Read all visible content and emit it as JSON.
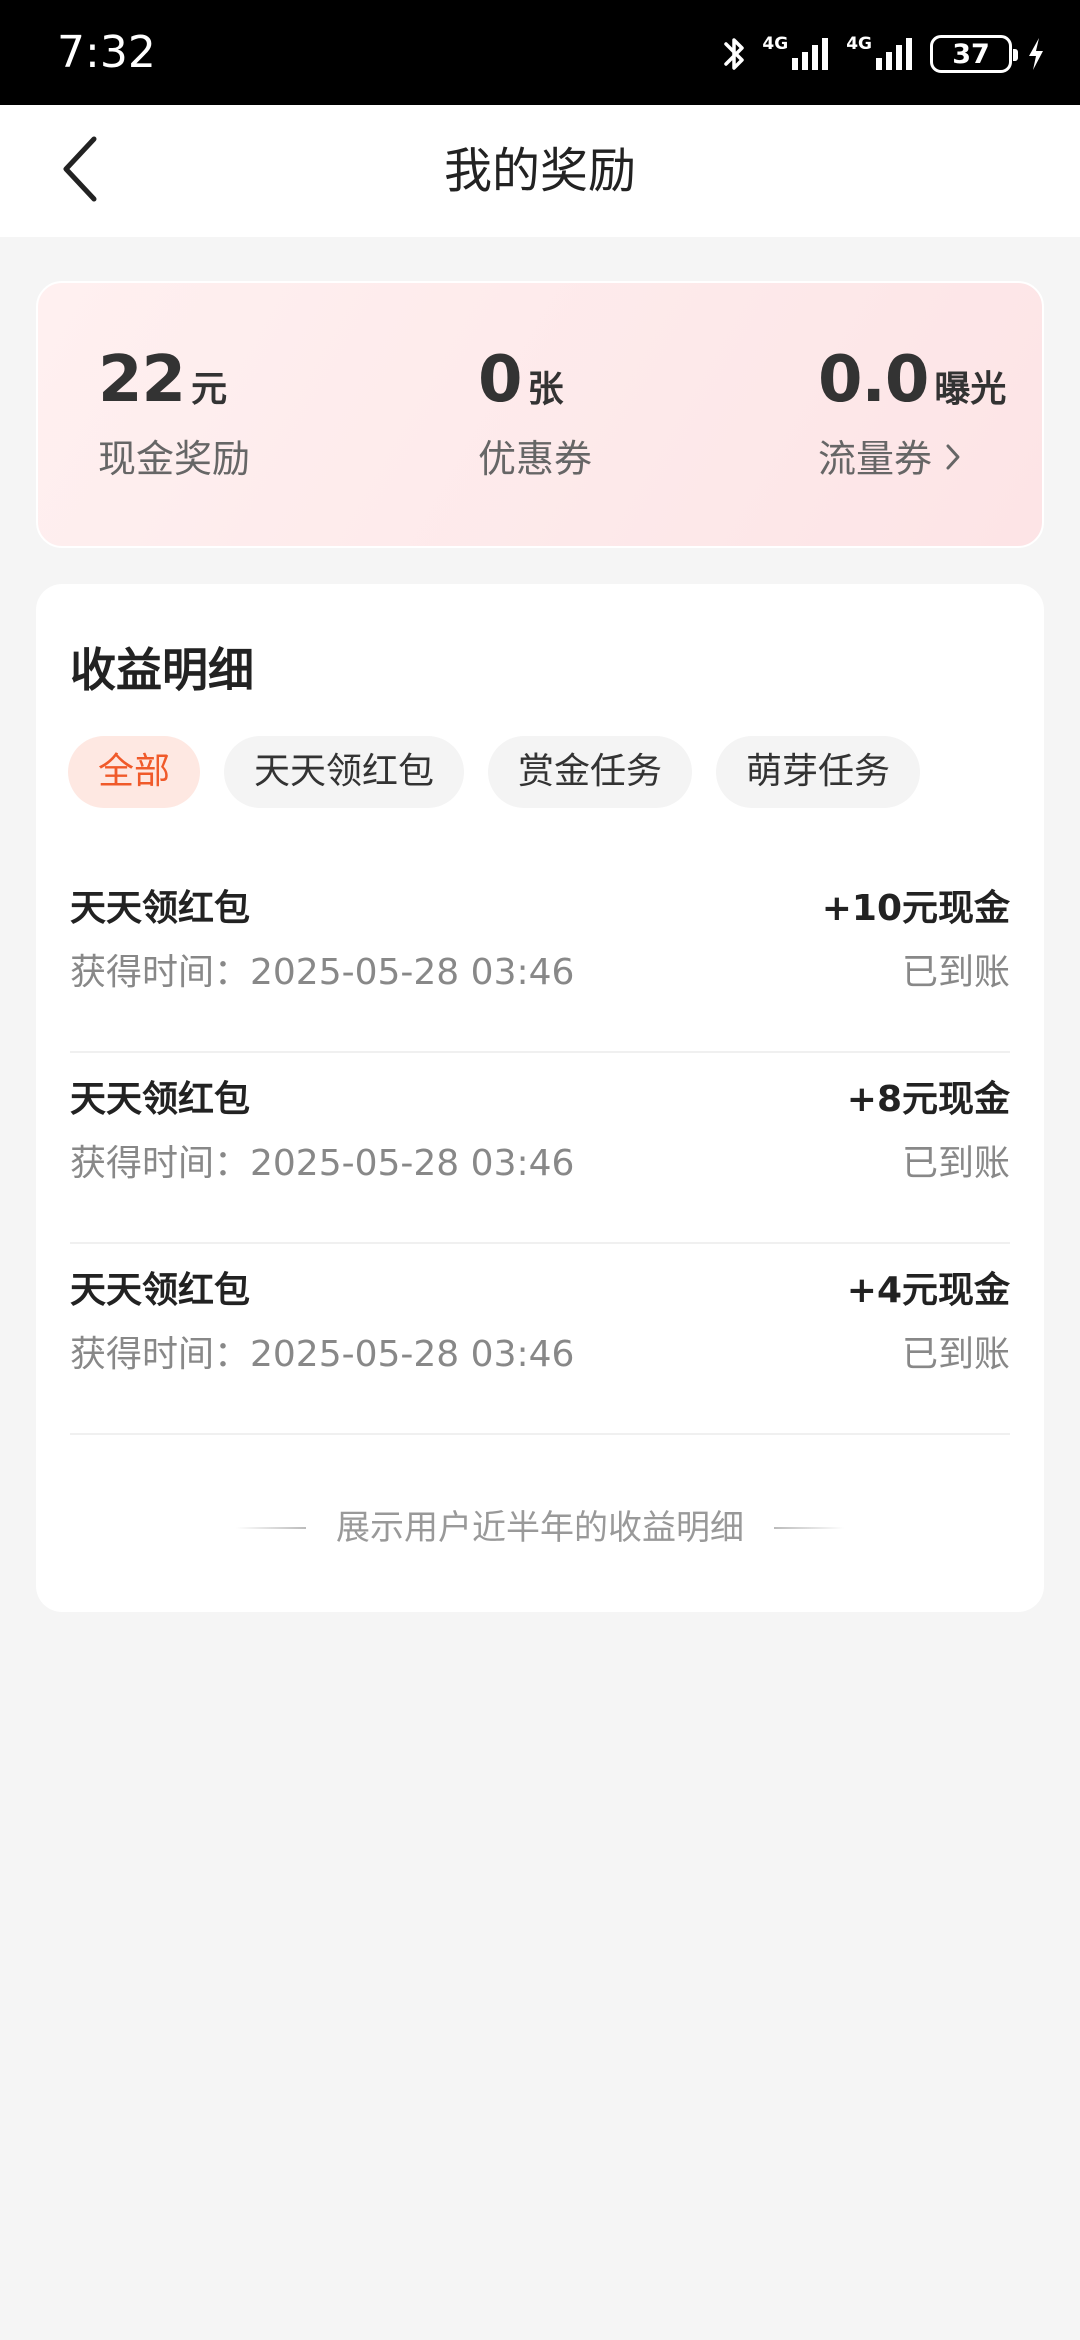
{
  "status_bar": {
    "time": "7:32",
    "network_1": "4G",
    "network_2": "4G",
    "battery": "37",
    "icons": [
      "bluetooth-icon",
      "signal-4g-icon",
      "signal-4g-icon",
      "battery-icon",
      "charging-icon"
    ]
  },
  "header": {
    "title": "我的奖励",
    "back_icon": "chevron-left-icon"
  },
  "summary": {
    "cash": {
      "value": "22",
      "unit": "元",
      "label": "现金奖励"
    },
    "coupon": {
      "value": "0",
      "unit": "张",
      "label": "优惠券"
    },
    "traffic": {
      "value": "0.0",
      "unit": "曝光",
      "label": "流量券",
      "arrow_icon": "chevron-right-icon"
    }
  },
  "details": {
    "title": "收益明细",
    "tabs": [
      {
        "label": "全部",
        "active": true
      },
      {
        "label": "天天领红包",
        "active": false
      },
      {
        "label": "赏金任务",
        "active": false
      },
      {
        "label": "萌芽任务",
        "active": false
      }
    ],
    "records": [
      {
        "title": "天天领红包",
        "amount": "+10元现金",
        "time": "获得时间：2025-05-28 03:46",
        "status": "已到账"
      },
      {
        "title": "天天领红包",
        "amount": "+8元现金",
        "time": "获得时间：2025-05-28 03:46",
        "status": "已到账"
      },
      {
        "title": "天天领红包",
        "amount": "+4元现金",
        "time": "获得时间：2025-05-28 03:46",
        "status": "已到账"
      }
    ],
    "footer_note": "展示用户近半年的收益明细"
  },
  "colors": {
    "accent": "#f05a2a",
    "active_tab_bg": "#fee8e2",
    "summary_bg": "#fde9ea",
    "page_bg": "#f5f5f5"
  }
}
